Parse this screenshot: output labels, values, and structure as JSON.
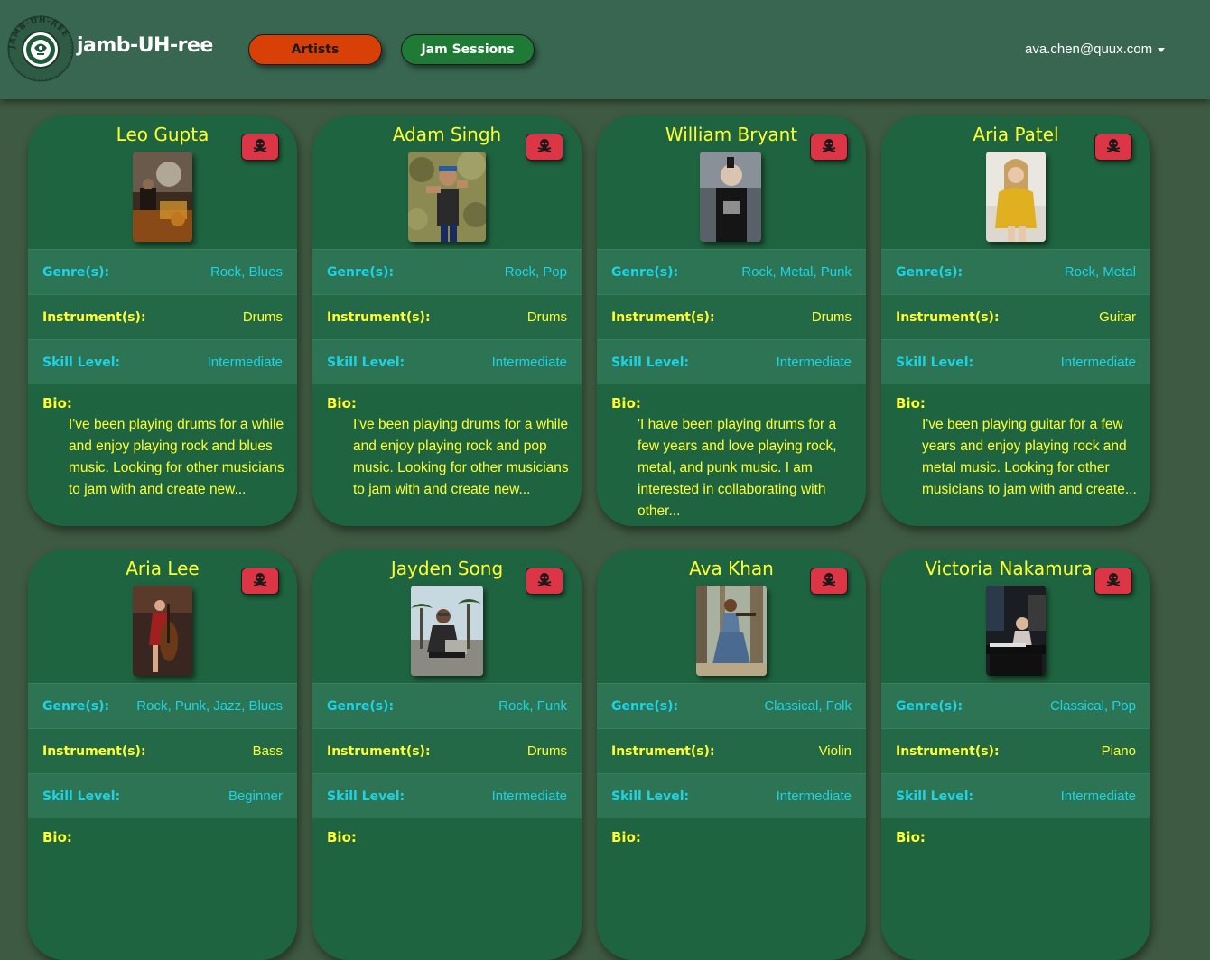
{
  "app": {
    "brand": "jamb-UH-ree",
    "logo_ring_text": "JAMB-UH-REE"
  },
  "nav": {
    "artists_label": "Artists",
    "jam_sessions_label": "Jam Sessions",
    "user_email": "ava.chen@quux.com"
  },
  "labels": {
    "genre": "Genre(s):",
    "instrument": "Instrument(s):",
    "skill": "Skill Level:",
    "bio": "Bio:"
  },
  "colors": {
    "page_bg": "#3f5a42",
    "navbar_bg": "#386650",
    "card_bg": "#1f6440",
    "artists_button": "#d84008",
    "jam_button": "#1f7a36",
    "delete_button": "#dc3545",
    "accent_yellow": "#ffff33",
    "accent_cyan": "#1fd3e6"
  },
  "artists": [
    {
      "name": "Leo Gupta",
      "genres": "Rock, Blues",
      "instruments": "Drums",
      "skill": "Intermediate",
      "bio": "I've been playing drums for a while and enjoy playing rock and blues music. Looking for other musicians to jam with and create new..."
    },
    {
      "name": "Adam Singh",
      "genres": "Rock, Pop",
      "instruments": "Drums",
      "skill": "Intermediate",
      "bio": "I've been playing drums for a while and enjoy playing rock and pop music. Looking for other musicians to jam with and create new..."
    },
    {
      "name": "William Bryant",
      "genres": "Rock, Metal, Punk",
      "instruments": "Drums",
      "skill": "Intermediate",
      "bio": "'I have been playing drums for a few years and love playing rock, metal, and punk music. I am interested in collaborating with other..."
    },
    {
      "name": "Aria Patel",
      "genres": "Rock, Metal",
      "instruments": "Guitar",
      "skill": "Intermediate",
      "bio": "I've been playing guitar for a few years and enjoy playing rock and metal music. Looking for other musicians to jam with and create..."
    },
    {
      "name": "Aria Lee",
      "genres": "Rock, Punk, Jazz, Blues",
      "instruments": "Bass",
      "skill": "Beginner",
      "bio": ""
    },
    {
      "name": "Jayden Song",
      "genres": "Rock, Funk",
      "instruments": "Drums",
      "skill": "Intermediate",
      "bio": ""
    },
    {
      "name": "Ava Khan",
      "genres": "Classical, Folk",
      "instruments": "Violin",
      "skill": "Intermediate",
      "bio": ""
    },
    {
      "name": "Victoria Nakamura",
      "genres": "Classical, Pop",
      "instruments": "Piano",
      "skill": "Intermediate",
      "bio": ""
    }
  ]
}
